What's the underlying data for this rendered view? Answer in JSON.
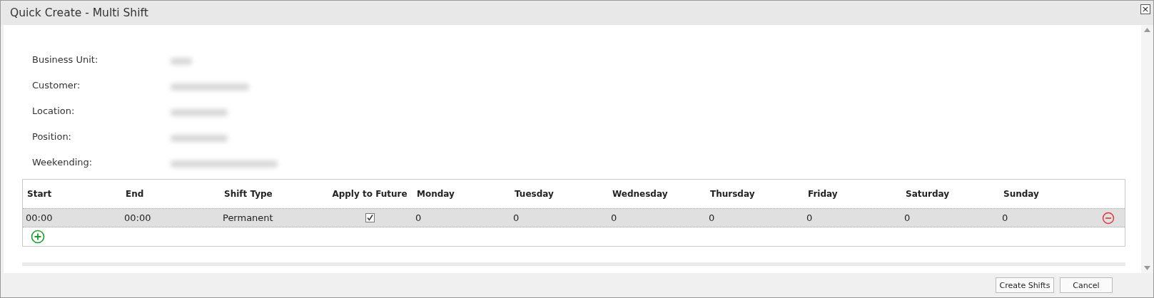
{
  "window": {
    "title": "Quick Create - Multi Shift",
    "close": "×"
  },
  "fields": [
    {
      "label": "Business Unit:"
    },
    {
      "label": "Customer:"
    },
    {
      "label": "Location:"
    },
    {
      "label": "Position:"
    },
    {
      "label": "Weekending:"
    }
  ],
  "table": {
    "columns": [
      "Start",
      "End",
      "Shift Type",
      "Apply to Future",
      "Monday",
      "Tuesday",
      "Wednesday",
      "Thursday",
      "Friday",
      "Saturday",
      "Sunday"
    ],
    "rows": [
      {
        "start": "00:00",
        "end": "00:00",
        "shift_type": "Permanent",
        "apply_to_future": true,
        "days": [
          "0",
          "0",
          "0",
          "0",
          "0",
          "0",
          "0"
        ]
      }
    ]
  },
  "buttons": [
    "Create Shifts",
    "Cancel"
  ]
}
